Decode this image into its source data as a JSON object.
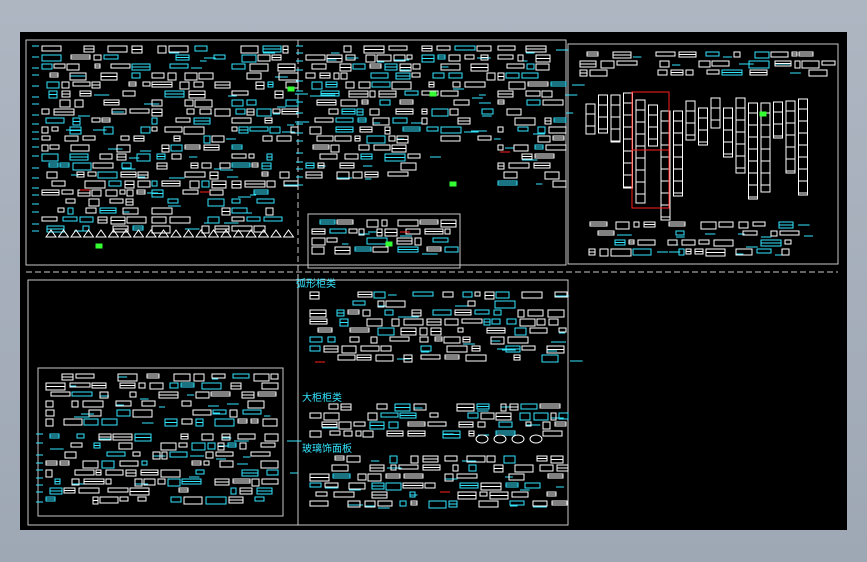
{
  "drawing": {
    "group_labels": {
      "arc_cabinets": "弧形柜类",
      "large_cabinets": "大柜柜类",
      "decorative_panels": "玻璃饰面板"
    }
  },
  "colors": {
    "background": "#000000",
    "frame": "#c8c8c8",
    "primary_lines": "#ffffff",
    "annotation": "#33e6ff",
    "highlight": "#ff2020",
    "accent": "#33ff33",
    "window_chrome": "#a8b0bc"
  }
}
